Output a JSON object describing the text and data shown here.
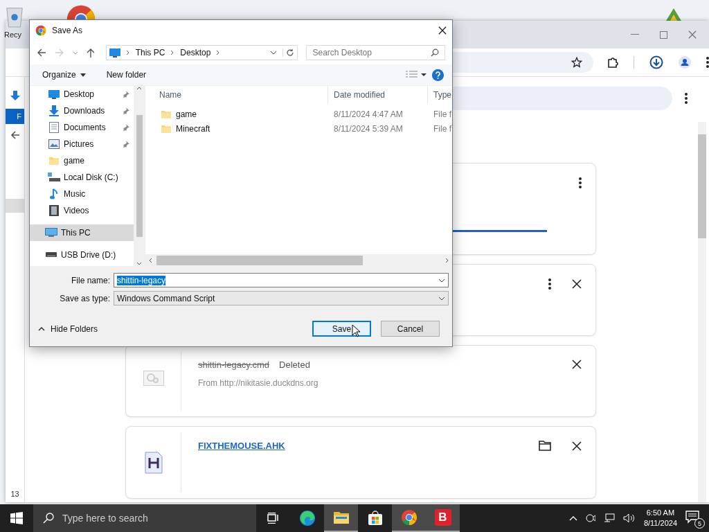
{
  "desktop": {
    "icons": [
      {
        "label": "Recy"
      }
    ]
  },
  "browser": {
    "rail": {
      "item": "F",
      "count": "13"
    },
    "downloads": [
      {
        "kind": "progress",
        "level": 1
      },
      {
        "kind": "pending"
      },
      {
        "kind": "deleted",
        "file": "shittin-legacy.cmd",
        "status": "Deleted",
        "source": "From http://nikitasie.duckdns.org"
      },
      {
        "kind": "done",
        "file": "FIXTHEMOUSE.AHK"
      }
    ]
  },
  "dialog": {
    "title": "Save As",
    "path": [
      "This PC",
      "Desktop"
    ],
    "search": {
      "placeholder": "Search Desktop"
    },
    "toolbar": [
      "Organize",
      "New folder"
    ],
    "nav": [
      {
        "label": "Desktop",
        "pinned": true,
        "selected": false
      },
      {
        "label": "Downloads",
        "pinned": true,
        "selected": false
      },
      {
        "label": "Documents",
        "pinned": true,
        "selected": false
      },
      {
        "label": "Pictures",
        "pinned": true,
        "selected": false
      },
      {
        "label": "game",
        "pinned": false,
        "selected": false
      },
      {
        "label": "Local Disk (C:)",
        "pinned": false,
        "selected": false
      },
      {
        "label": "Music",
        "pinned": false,
        "selected": false
      },
      {
        "label": "Videos",
        "pinned": false,
        "selected": false
      },
      {
        "label": "This PC",
        "pinned": false,
        "selected": true
      },
      {
        "label": "USB Drive (D:)",
        "pinned": false,
        "selected": false
      }
    ],
    "columns": [
      "Name",
      "Date modified",
      "Type"
    ],
    "rows": [
      {
        "name": "game",
        "date": "8/11/2024 4:47 AM",
        "type": "File f"
      },
      {
        "name": "Minecraft",
        "date": "8/11/2024 5:39 AM",
        "type": "File f"
      }
    ],
    "file_name": {
      "label": "File name:",
      "value": "shittin-legacy"
    },
    "save_type": {
      "label": "Save as type:",
      "value": "Windows Command Script"
    },
    "hide_folders": "Hide Folders",
    "buttons": [
      {
        "label": "Save",
        "default": true
      },
      {
        "label": "Cancel",
        "default": false
      }
    ]
  },
  "taskbar": {
    "search": {
      "placeholder": "Type here to search"
    },
    "apps": [
      {
        "kind": "taskview",
        "active": false
      },
      {
        "kind": "edge",
        "active": false
      },
      {
        "kind": "explorer",
        "active": true
      },
      {
        "kind": "store",
        "active": false
      },
      {
        "kind": "chrome",
        "active": true
      },
      {
        "kind": "letter",
        "label": "B",
        "active": true
      }
    ],
    "time": "6:50 AM",
    "date": "8/11/2024",
    "notifications": "5"
  }
}
